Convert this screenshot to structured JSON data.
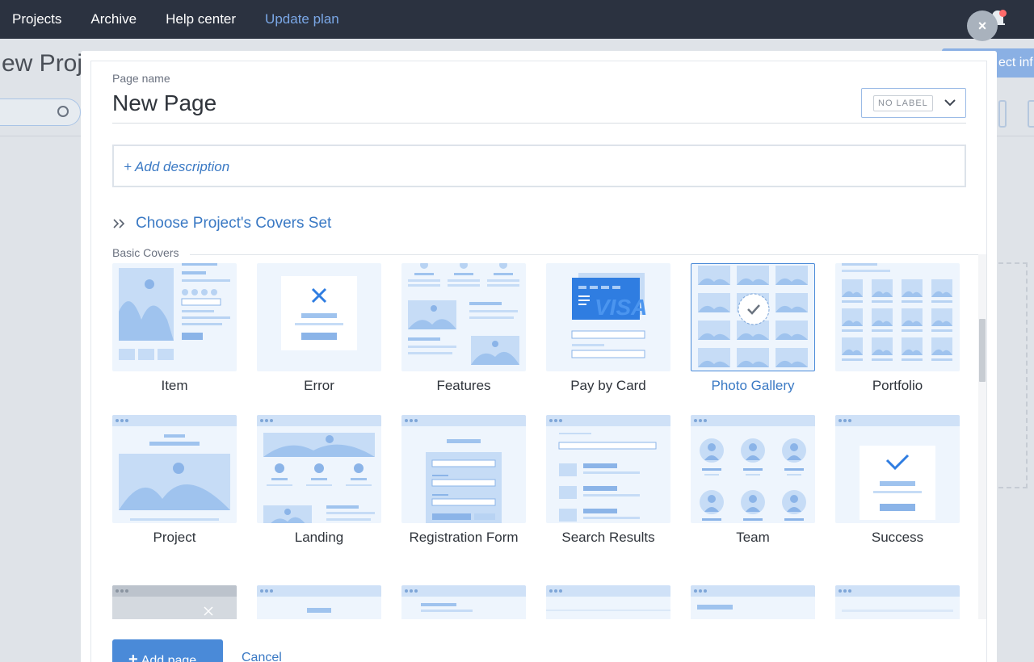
{
  "topnav": {
    "links": [
      "Projects",
      "Archive",
      "Help center"
    ],
    "upgrade": "Update plan"
  },
  "background": {
    "title": "ew Proj",
    "button": "ect inf"
  },
  "modal": {
    "close": "×",
    "page_name_label": "Page name",
    "page_name_value": "New Page",
    "label_dropdown": "NO LABEL",
    "description_placeholder": "+ Add description",
    "covers_heading": "Choose Project's Covers Set",
    "basic_covers_label": "Basic Covers",
    "covers": [
      {
        "name": "Item"
      },
      {
        "name": "Error"
      },
      {
        "name": "Features"
      },
      {
        "name": "Pay by Card"
      },
      {
        "name": "Photo Gallery",
        "selected": true
      },
      {
        "name": "Portfolio"
      },
      {
        "name": "Project"
      },
      {
        "name": "Landing"
      },
      {
        "name": "Registration Form"
      },
      {
        "name": "Search Results"
      },
      {
        "name": "Team"
      },
      {
        "name": "Success"
      }
    ],
    "add_button": "Add page",
    "cancel_button": "Cancel"
  },
  "colors": {
    "nav_bg": "#2b3240",
    "accent": "#4a8ad8",
    "link": "#3a79c4"
  }
}
